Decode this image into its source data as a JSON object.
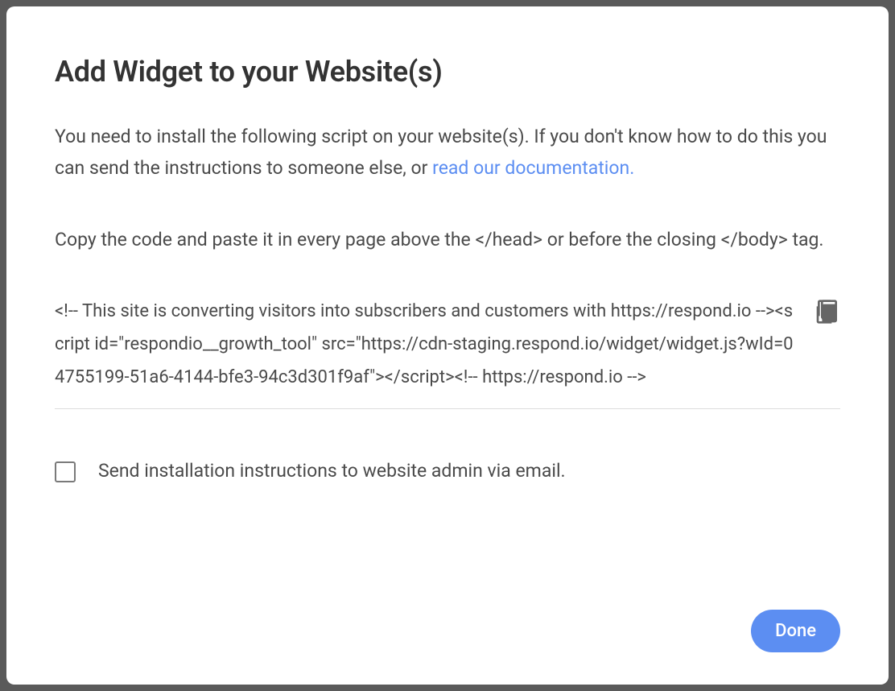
{
  "modal": {
    "title": "Add Widget to your Website(s)",
    "intro_prefix": "You need to install the following script on your website(s). If you don't know how to do this you can send the instructions to someone else, or ",
    "doc_link_text": "read our documentation.",
    "instruction": "Copy the code and paste it in every page above the </head> or before the closing </body> tag.",
    "code_snippet": "<!-- This site is converting visitors into subscribers and customers with https://respond.io --><script id=\"respondio__growth_tool\" src=\"https://cdn-staging.respond.io/widget/widget.js?wId=04755199-51a6-4144-bfe3-94c3d301f9af\"></script><!-- https://respond.io -->",
    "checkbox_label": "Send installation instructions to website admin via email.",
    "done_label": "Done"
  }
}
